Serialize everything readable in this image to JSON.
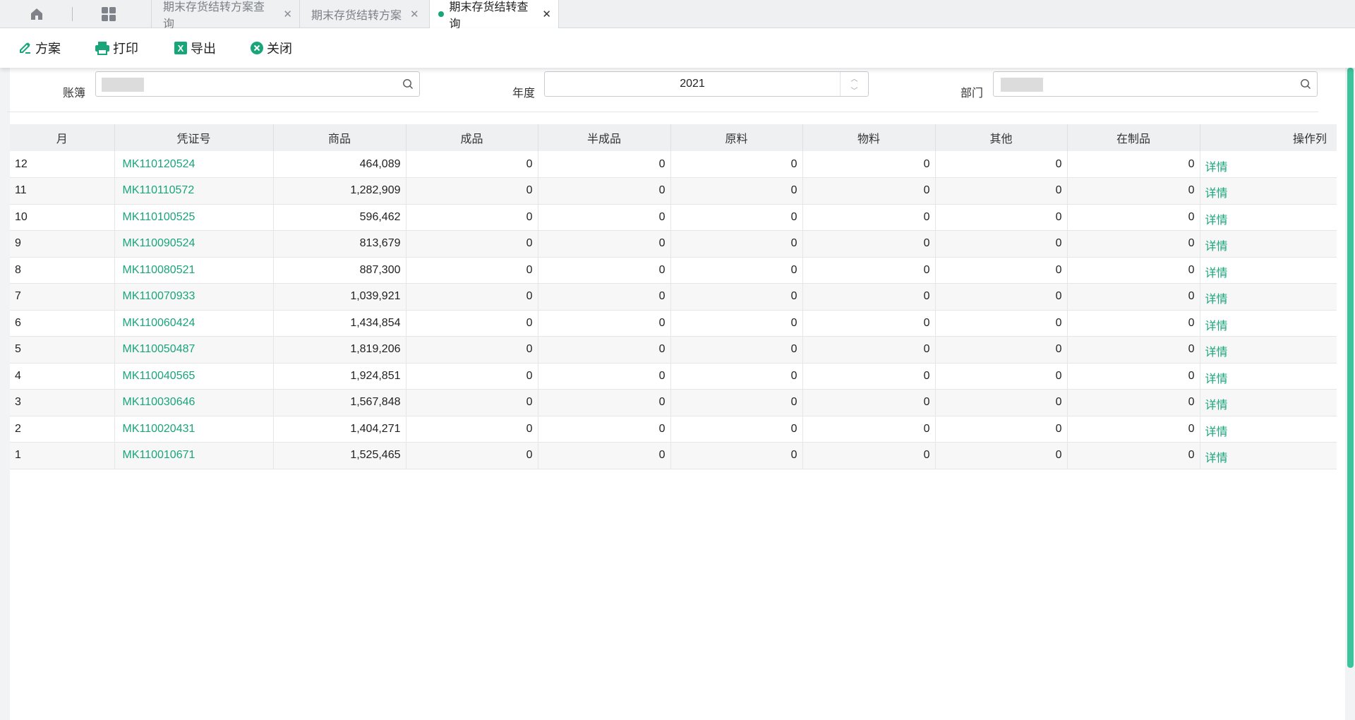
{
  "tabs": [
    {
      "label": "期末存货结转方案查询",
      "active": false
    },
    {
      "label": "期末存货结转方案",
      "active": false
    },
    {
      "label": "期末存货结转查询",
      "active": true
    }
  ],
  "toolbar": {
    "scheme": "方案",
    "print": "打印",
    "export": "导出",
    "close": "关闭"
  },
  "filters": {
    "ledger_label": "账簿",
    "year_label": "年度",
    "year_value": "2021",
    "dept_label": "部门"
  },
  "table": {
    "columns": [
      "月",
      "凭证号",
      "商品",
      "成品",
      "半成品",
      "原料",
      "物料",
      "其他",
      "在制品",
      "操作列"
    ],
    "detail_label": "详情",
    "rows": [
      {
        "month": "12",
        "voucher": "MK110120524",
        "goods": "464,089",
        "finished": "0",
        "semi": "0",
        "raw": "0",
        "material": "0",
        "other": "0",
        "wip": "0"
      },
      {
        "month": "11",
        "voucher": "MK110110572",
        "goods": "1,282,909",
        "finished": "0",
        "semi": "0",
        "raw": "0",
        "material": "0",
        "other": "0",
        "wip": "0"
      },
      {
        "month": "10",
        "voucher": "MK110100525",
        "goods": "596,462",
        "finished": "0",
        "semi": "0",
        "raw": "0",
        "material": "0",
        "other": "0",
        "wip": "0"
      },
      {
        "month": "9",
        "voucher": "MK110090524",
        "goods": "813,679",
        "finished": "0",
        "semi": "0",
        "raw": "0",
        "material": "0",
        "other": "0",
        "wip": "0"
      },
      {
        "month": "8",
        "voucher": "MK110080521",
        "goods": "887,300",
        "finished": "0",
        "semi": "0",
        "raw": "0",
        "material": "0",
        "other": "0",
        "wip": "0"
      },
      {
        "month": "7",
        "voucher": "MK110070933",
        "goods": "1,039,921",
        "finished": "0",
        "semi": "0",
        "raw": "0",
        "material": "0",
        "other": "0",
        "wip": "0"
      },
      {
        "month": "6",
        "voucher": "MK110060424",
        "goods": "1,434,854",
        "finished": "0",
        "semi": "0",
        "raw": "0",
        "material": "0",
        "other": "0",
        "wip": "0"
      },
      {
        "month": "5",
        "voucher": "MK110050487",
        "goods": "1,819,206",
        "finished": "0",
        "semi": "0",
        "raw": "0",
        "material": "0",
        "other": "0",
        "wip": "0"
      },
      {
        "month": "4",
        "voucher": "MK110040565",
        "goods": "1,924,851",
        "finished": "0",
        "semi": "0",
        "raw": "0",
        "material": "0",
        "other": "0",
        "wip": "0"
      },
      {
        "month": "3",
        "voucher": "MK110030646",
        "goods": "1,567,848",
        "finished": "0",
        "semi": "0",
        "raw": "0",
        "material": "0",
        "other": "0",
        "wip": "0"
      },
      {
        "month": "2",
        "voucher": "MK110020431",
        "goods": "1,404,271",
        "finished": "0",
        "semi": "0",
        "raw": "0",
        "material": "0",
        "other": "0",
        "wip": "0"
      },
      {
        "month": "1",
        "voucher": "MK110010671",
        "goods": "1,525,465",
        "finished": "0",
        "semi": "0",
        "raw": "0",
        "material": "0",
        "other": "0",
        "wip": "0"
      }
    ]
  },
  "colors": {
    "accent": "#18a57a",
    "scrollbar": "#3ec49c"
  }
}
